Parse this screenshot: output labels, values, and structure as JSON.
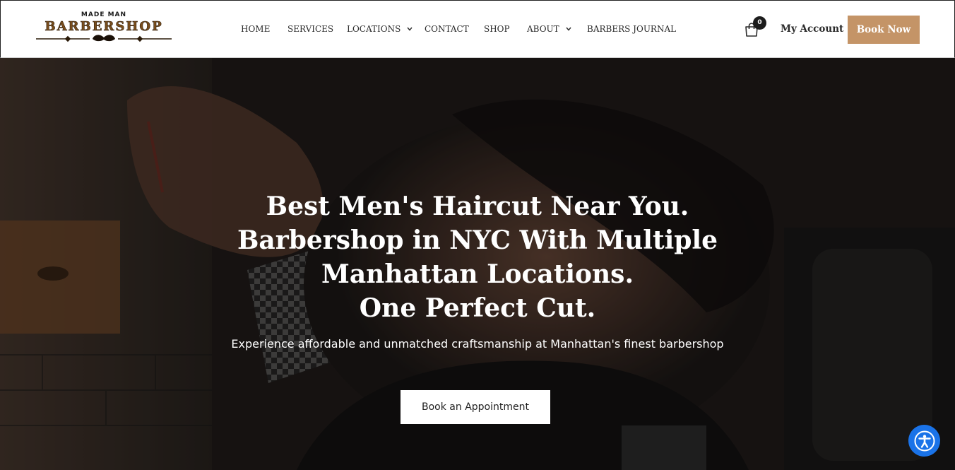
{
  "brand": {
    "logo_top": "MADE MAN",
    "logo_main": "BARBERSHOP",
    "accent_color": "#c49467",
    "logo_color": "#7a4e1d"
  },
  "nav": {
    "items": [
      {
        "label": "HOME",
        "has_dropdown": false
      },
      {
        "label": "SERVICES",
        "has_dropdown": false
      },
      {
        "label": "LOCATIONS",
        "has_dropdown": true
      },
      {
        "label": "CONTACT",
        "has_dropdown": false
      },
      {
        "label": "SHOP",
        "has_dropdown": false
      },
      {
        "label": "ABOUT",
        "has_dropdown": true
      },
      {
        "label": "BARBERS JOURNAL",
        "has_dropdown": false
      }
    ]
  },
  "header_actions": {
    "cart_icon": "shopping-bag-icon",
    "cart_count": "0",
    "account_label": "My Account",
    "book_label": "Book Now"
  },
  "hero": {
    "title_lines": [
      "Best Men's Haircut Near You.",
      "Barbershop in NYC With Multiple",
      "Manhattan Locations.",
      "One Perfect Cut."
    ],
    "subtitle": "Experience affordable and unmatched craftsmanship at Manhattan's finest barbershop",
    "cta_label": "Book an Appointment",
    "background": "barber-shaving-client-photo"
  },
  "accessibility": {
    "icon": "accessibility-icon",
    "color": "#1a73e8"
  }
}
